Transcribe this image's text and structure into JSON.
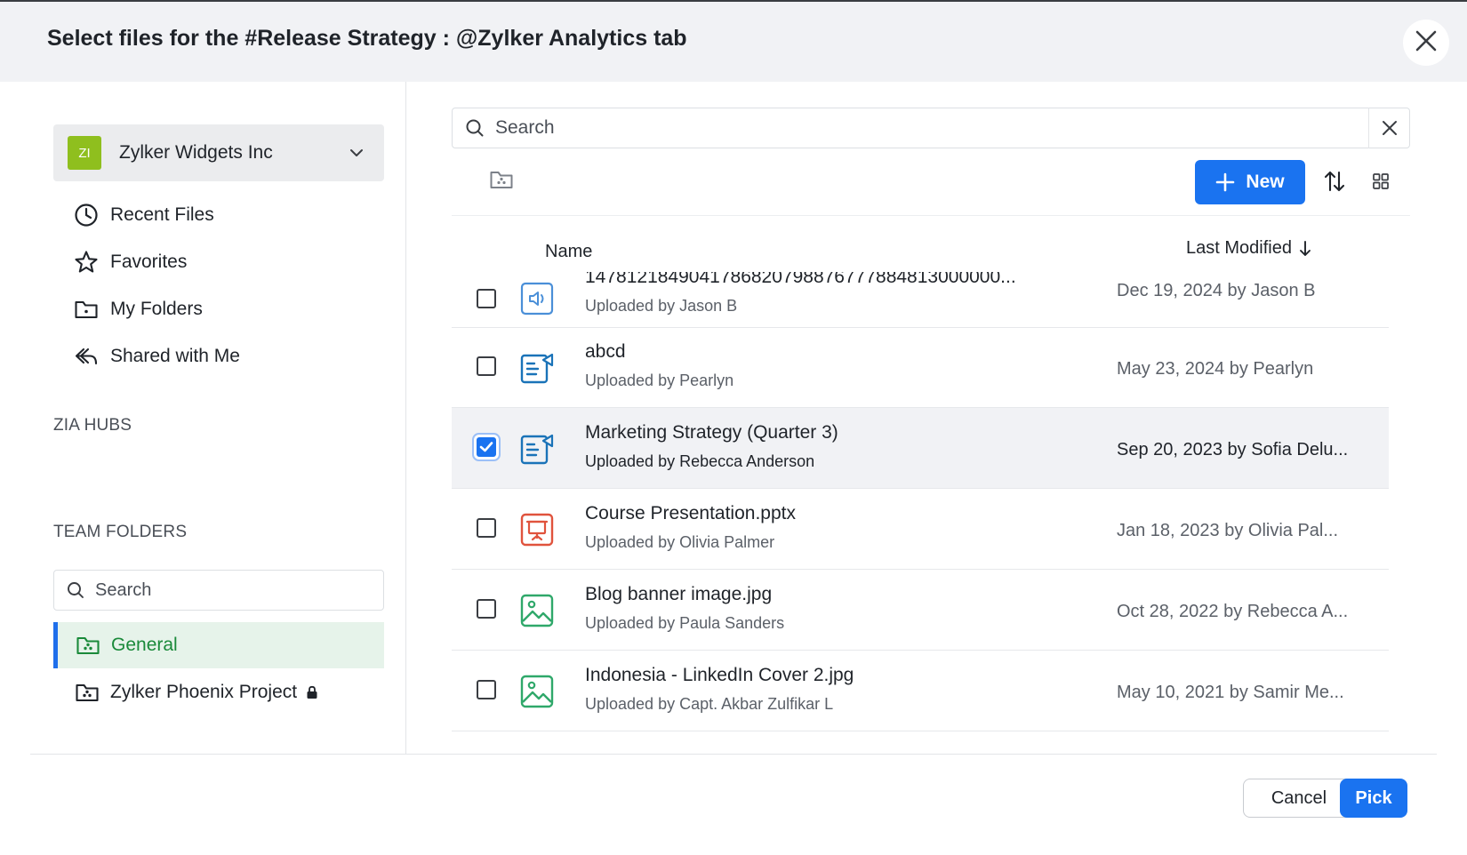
{
  "dialog": {
    "title": "Select files for the #Release Strategy : @Zylker Analytics tab",
    "close_icon": "close-icon"
  },
  "sidebar": {
    "org": {
      "initials": "ZI",
      "name": "Zylker Widgets Inc",
      "avatar_color": "#8fbf1e"
    },
    "nav_items": [
      {
        "label": "Recent Files",
        "icon": "clock-icon"
      },
      {
        "label": "Favorites",
        "icon": "star-icon"
      },
      {
        "label": "My Folders",
        "icon": "folder-icon"
      },
      {
        "label": "Shared with Me",
        "icon": "share-icon"
      }
    ],
    "zia_hubs_label": "ZIA HUBS",
    "team_folders_label": "TEAM FOLDERS",
    "team_search_placeholder": "Search",
    "team_folders": [
      {
        "label": "General",
        "active": true,
        "icon": "team-folder-icon"
      },
      {
        "label": "Zylker Phoenix Project",
        "active": false,
        "icon": "team-folder-icon",
        "locked": true
      }
    ]
  },
  "main": {
    "search_placeholder": "Search",
    "new_button_label": "New",
    "columns": {
      "name": "Name",
      "last_modified": "Last Modified"
    },
    "files": [
      {
        "name": "1478121849041786820798876777884813000000...",
        "uploader": "Uploaded by Jason B",
        "modified": "Dec 19, 2024 by Jason B",
        "icon": "audio-file-icon",
        "selected": false
      },
      {
        "name": "abcd",
        "uploader": "Uploaded by Pearlyn",
        "modified": "May 23, 2024 by Pearlyn",
        "icon": "presentation-doc-icon",
        "selected": false
      },
      {
        "name": "Marketing Strategy (Quarter 3)",
        "uploader": "Uploaded by Rebecca Anderson",
        "modified": "Sep 20, 2023 by Sofia Delu...",
        "icon": "presentation-doc-icon",
        "selected": true
      },
      {
        "name": "Course Presentation.pptx",
        "uploader": "Uploaded by Olivia Palmer",
        "modified": "Jan 18, 2023 by Olivia Pal...",
        "icon": "pptx-icon",
        "selected": false
      },
      {
        "name": "Blog banner image.jpg",
        "uploader": "Uploaded by Paula Sanders",
        "modified": "Oct 28, 2022 by Rebecca A...",
        "icon": "image-file-icon",
        "selected": false
      },
      {
        "name": "Indonesia - LinkedIn Cover 2.jpg",
        "uploader": "Uploaded by Capt. Akbar Zulfikar L",
        "modified": "May 10, 2021 by Samir Me...",
        "icon": "image-file-icon",
        "selected": false
      }
    ]
  },
  "footer": {
    "cancel_label": "Cancel",
    "pick_label": "Pick"
  },
  "colors": {
    "accent": "#1a73f0",
    "active_folder_text": "#1a8a3a",
    "active_folder_bg": "#e6f3ea",
    "doc_icon": "#1a73b8",
    "pptx_icon": "#e0533d",
    "image_icon": "#2fa86a"
  }
}
